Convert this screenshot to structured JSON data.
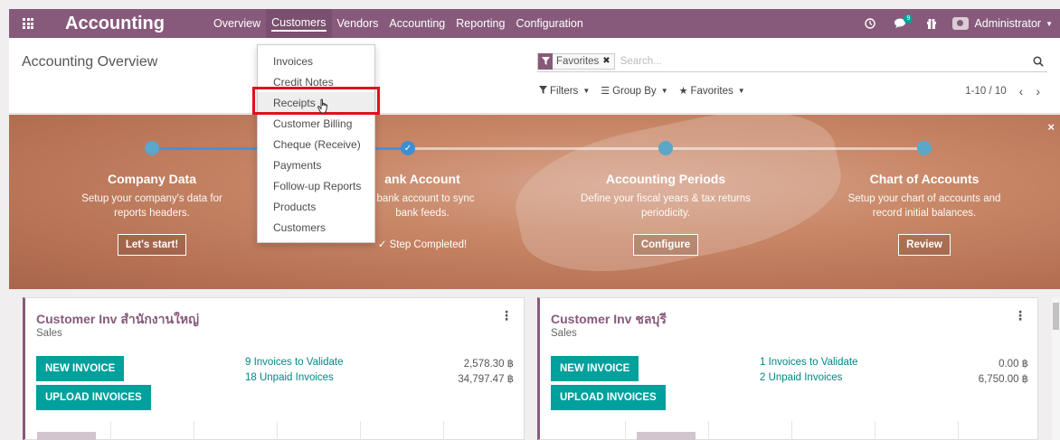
{
  "navbar": {
    "brand": "Accounting",
    "menu": [
      {
        "label": "Overview",
        "active": false
      },
      {
        "label": "Customers",
        "active": true
      },
      {
        "label": "Vendors",
        "active": false
      },
      {
        "label": "Accounting",
        "active": false
      },
      {
        "label": "Reporting",
        "active": false
      },
      {
        "label": "Configuration",
        "active": false
      }
    ],
    "messages_badge": "9",
    "user": "Administrator",
    "color": "#875a7b"
  },
  "control_panel": {
    "title": "Accounting Overview",
    "facet_label": "Favorites",
    "search_placeholder": "Search...",
    "filters_label": "Filters",
    "groupby_label": "Group By",
    "favorites_label": "Favorites",
    "pager": "1-10 / 10"
  },
  "customers_menu": {
    "items": [
      "Invoices",
      "Credit Notes",
      "Receipts",
      "Customer Billing",
      "Cheque (Receive)",
      "Payments",
      "Follow-up Reports",
      "Products",
      "Customers"
    ],
    "hovered": "Receipts",
    "highlight_color": "#e0101e"
  },
  "banner": {
    "steps": [
      {
        "title": "Company Data",
        "desc1": "Setup your company's data for",
        "desc2": "reports headers.",
        "button": "Let's start!"
      },
      {
        "title": "ank Account",
        "desc1": "r bank account to sync",
        "desc2": "bank feeds.",
        "done": "Step Completed!"
      },
      {
        "title": "Accounting Periods",
        "desc1": "Define your fiscal years & tax returns",
        "desc2": "periodicity.",
        "button": "Configure"
      },
      {
        "title": "Chart of Accounts",
        "desc1": "Setup your chart of accounts and",
        "desc2": "record initial balances.",
        "button": "Review"
      }
    ]
  },
  "journals": [
    {
      "title": "Customer Inv สำนักงานใหญ่",
      "subtitle": "Sales",
      "new_button": "NEW INVOICE",
      "upload_button": "UPLOAD INVOICES",
      "stat1_label": "9 Invoices to Validate",
      "stat1_value": "2,578.30 ฿",
      "stat2_label": "18 Unpaid Invoices",
      "stat2_value": "34,797.47 ฿"
    },
    {
      "title": "Customer Inv ชลบุรี",
      "subtitle": "Sales",
      "new_button": "NEW INVOICE",
      "upload_button": "UPLOAD INVOICES",
      "stat1_label": "1 Invoices to Validate",
      "stat1_value": "0.00 ฿",
      "stat2_label": "2 Unpaid Invoices",
      "stat2_value": "6,750.00 ฿"
    }
  ],
  "icons": [
    "apps-grid-icon",
    "clock-icon",
    "chat-icon",
    "gift-icon",
    "user-avatar-icon",
    "filter-icon",
    "search-icon",
    "star-icon",
    "check-icon",
    "kebab-icon",
    "hand-cursor-icon"
  ]
}
